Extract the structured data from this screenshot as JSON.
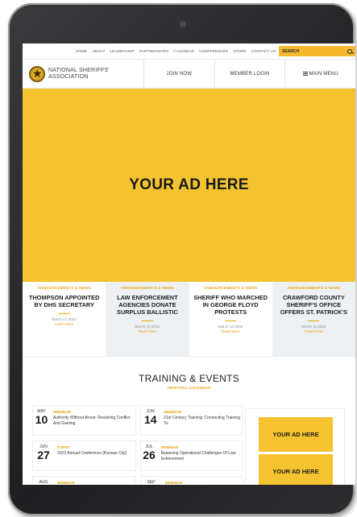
{
  "topnav": {
    "links": [
      "HOME",
      "ABOUT",
      "LEADERSHIP",
      "PARTNERSHIPS",
      "CALENDAR",
      "CONFERENCES",
      "STORE",
      "CONTACT US"
    ],
    "search_placeholder": "SEARCH",
    "search_icon": "magnifier-icon",
    "search_bg": "#f5b82e"
  },
  "header": {
    "brand_line1": "NATIONAL SHERIFFS'",
    "brand_line2": "ASSOCIATION",
    "join": "JOIN NOW",
    "login": "MEMBER LOGIN",
    "menu": "MAIN MENU"
  },
  "hero": {
    "label": "YOUR AD HERE",
    "bg": "#f5c330"
  },
  "news": [
    {
      "category": "ANNOUNCEMENTS & NEWS",
      "title": "THOMPSON APPOINTED BY DHS SECRETARY",
      "date": "March 17,2022",
      "more": "Learn More"
    },
    {
      "category": "ANNOUNCEMENTS & NEWS",
      "title": "LAW ENFORCEMENT AGENCIES DONATE SURPLUS BALLISTIC",
      "date": "March 14,2022",
      "more": "Read More"
    },
    {
      "category": "ANNOUNCEMENTS & NEWS",
      "title": "SHERIFF WHO MARCHED IN GEORGE FLOYD PROTESTS",
      "date": "March 12,2022",
      "more": "Read More"
    },
    {
      "category": "ANNOUNCEMENTS & NEWS",
      "title": "CRAWFORD COUNTY SHERIFF'S OFFICE OFFERS ST. PATRICK'S",
      "date": "March 11,2022",
      "more": "Read More"
    }
  ],
  "training": {
    "heading": "TRAINING & EVENTS",
    "view_all": "VIEW FULL CALENDAR",
    "events": [
      {
        "month": "MAY",
        "day": "10",
        "type": "WEBINAR",
        "title": "Authority Without Arrest: Resolving Conflict And Gaining"
      },
      {
        "month": "JUN",
        "day": "14",
        "type": "WEBINAR",
        "title": "21st Century Training: Connecting Training To"
      },
      {
        "month": "JUN",
        "day": "27",
        "type": "EVENT",
        "title": "2022 Annual Conference [Kansas City]"
      },
      {
        "month": "JUL",
        "day": "26",
        "type": "WEBINAR",
        "title": "Balancing Operational Challenges Of Law Enforcement"
      },
      {
        "month": "AUG",
        "day": "",
        "type": "WEBINAR",
        "title": ""
      },
      {
        "month": "SEP",
        "day": "",
        "type": "WEBINAR",
        "title": ""
      }
    ],
    "side_ads": [
      "YOUR AD HERE",
      "YOUR AD HERE"
    ]
  },
  "accent": "#e6a40c"
}
